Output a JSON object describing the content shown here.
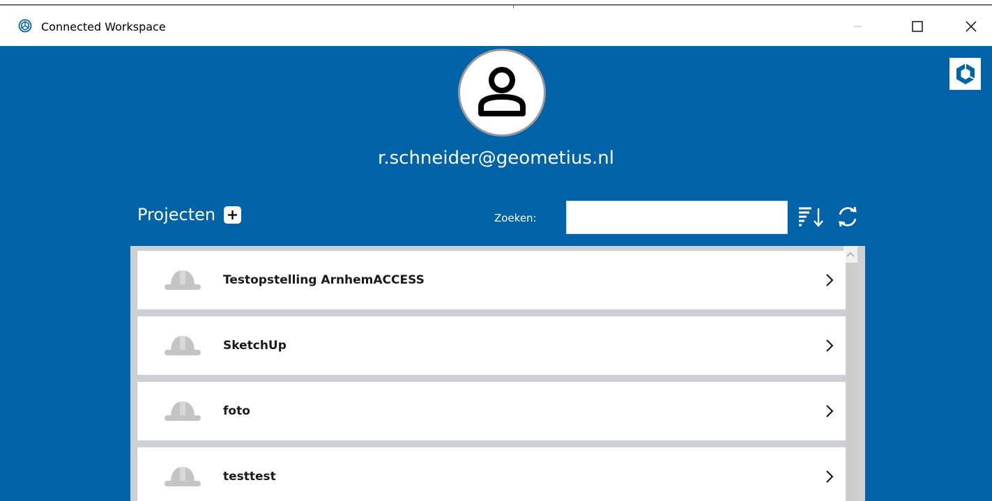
{
  "window": {
    "title": "Connected Workspace",
    "minimize_label": "—",
    "maximize_label": "☐",
    "close_label": "✕"
  },
  "user": {
    "email": "r.schneider@geometius.nl"
  },
  "projects_section": {
    "heading": "Projecten",
    "add_label": "+"
  },
  "search": {
    "label": "Zoeken:",
    "value": ""
  },
  "projects": [
    {
      "name": "Testopstelling ArnhemACCESS"
    },
    {
      "name": "SketchUp"
    },
    {
      "name": "foto"
    },
    {
      "name": "testtest"
    }
  ],
  "colors": {
    "accent": "#0063a8",
    "list_bg": "#ccd0d6",
    "icon_gray": "#c4c4c4"
  },
  "icons": {
    "app": "app-logo-icon",
    "user": "user-icon",
    "brand": "brand-logo-icon",
    "add": "plus-icon",
    "sort": "sort-icon",
    "refresh": "refresh-icon",
    "project": "hardhat-icon",
    "chevron": "chevron-right-icon"
  }
}
